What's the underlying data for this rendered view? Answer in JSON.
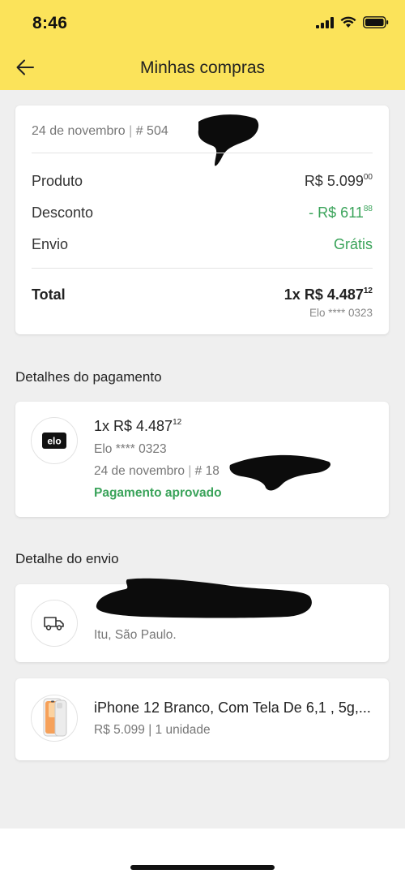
{
  "status_bar": {
    "time": "8:46"
  },
  "header": {
    "title": "Minhas compras"
  },
  "summary": {
    "date": "24 de novembro",
    "order_prefix": "# 504",
    "product_label": "Produto",
    "product_value": "R$ 5.099",
    "product_cents": "00",
    "discount_label": "Desconto",
    "discount_value": "- R$ 611",
    "discount_cents": "88",
    "shipping_label": "Envio",
    "shipping_value": "Grátis",
    "total_label": "Total",
    "total_value": "1x R$ 4.487",
    "total_cents": "12",
    "total_card": "Elo **** 0323"
  },
  "payment": {
    "section_title": "Detalhes do pagamento",
    "card_brand": "elo",
    "amount": "1x R$ 4.487",
    "amount_cents": "12",
    "card": "Elo **** 0323",
    "date": "24 de novembro",
    "id_prefix": "# 18",
    "status": "Pagamento aprovado"
  },
  "shipping": {
    "section_title": "Detalhe do envio",
    "city": "Itu, São Paulo."
  },
  "product": {
    "name": "iPhone 12 Branco, Com Tela De 6,1 , 5g,...",
    "details": "R$ 5.099 | 1 unidade"
  },
  "colors": {
    "header": "#fbe35a",
    "approved": "#3aa35a"
  },
  "icons": [
    "back-arrow-icon",
    "signal-icon",
    "wifi-icon",
    "battery-icon",
    "elo-logo-icon",
    "truck-icon"
  ]
}
